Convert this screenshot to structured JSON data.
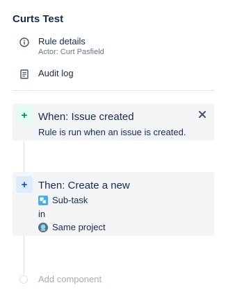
{
  "title": "Curts Test",
  "nav": {
    "rule_details": {
      "label": "Rule details",
      "sublabel": "Actor: Curt Pasfield",
      "icon": "info-icon"
    },
    "audit_log": {
      "label": "Audit log",
      "icon": "document-icon"
    }
  },
  "trigger": {
    "badge": "+",
    "title": "When: Issue created",
    "description": "Rule is run when an issue is created.",
    "close_symbol": "×"
  },
  "action": {
    "badge": "+",
    "title": "Then: Create a new",
    "issue_type": "Sub-task",
    "connector": "in",
    "project": "Same project"
  },
  "add_component": {
    "label": "Add component"
  },
  "colors": {
    "trigger_accent": "#00875a",
    "action_accent": "#0052cc",
    "card_bg": "#f4f5f7",
    "text_primary": "#172b4d",
    "text_secondary": "#6b778c"
  }
}
